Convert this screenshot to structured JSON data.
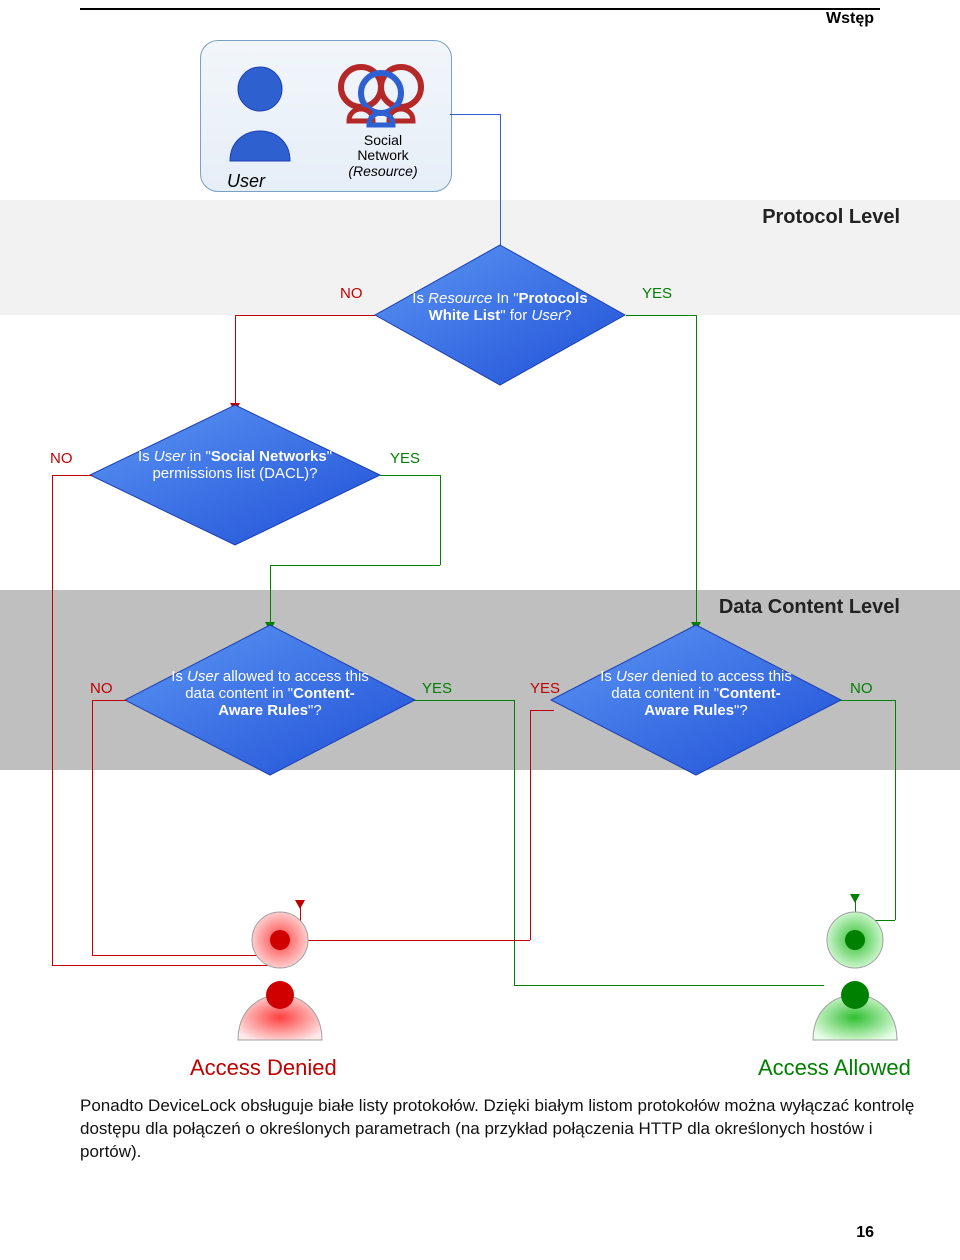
{
  "header": {
    "section_name": "Wstęp",
    "page_number": "16"
  },
  "top_box": {
    "user_label": "User",
    "resource_label_line1": "Social",
    "resource_label_line2": "Network",
    "resource_label_line3": "(Resource)"
  },
  "sections": {
    "protocol_title": "Protocol Level",
    "data_title": "Data Content Level"
  },
  "decisions": {
    "d1": "Is Resource In \"Protocols White List\" for User?",
    "d2": "Is User in \"Social Networks\" permissions list (DACL)?",
    "d3": "Is User allowed to access this data content in \"Content-Aware Rules\"?",
    "d4": "Is User denied to access this data content in \"Content-Aware Rules\"?"
  },
  "edge_labels": {
    "yes": "YES",
    "no": "NO"
  },
  "results": {
    "denied": "Access Denied",
    "allowed": "Access Allowed"
  },
  "body_text": "Ponadto DeviceLock obsługuje białe listy protokołów. Dzięki białym listom protokołów można wyłączać kontrolę dostępu dla połączeń o określonych parametrach (na przykład połączenia HTTP dla określonych hostów i portów).",
  "chart_data": {
    "type": "flowchart",
    "start": {
      "id": "start",
      "label": "User + Social Network (Resource)"
    },
    "phases": [
      "Protocol Level",
      "Data Content Level"
    ],
    "nodes": [
      {
        "id": "d1",
        "type": "decision",
        "phase": "Protocol Level",
        "text": "Is Resource In \"Protocols White List\" for User?"
      },
      {
        "id": "d2",
        "type": "decision",
        "phase": "Protocol Level",
        "text": "Is User in \"Social Networks\" permissions list (DACL)?"
      },
      {
        "id": "d3",
        "type": "decision",
        "phase": "Data Content Level",
        "text": "Is User allowed to access this data content in \"Content-Aware Rules\"?"
      },
      {
        "id": "d4",
        "type": "decision",
        "phase": "Data Content Level",
        "text": "Is User denied to access this data content in \"Content-Aware Rules\"?"
      },
      {
        "id": "denied",
        "type": "terminal",
        "label": "Access Denied",
        "color": "red"
      },
      {
        "id": "allowed",
        "type": "terminal",
        "label": "Access Allowed",
        "color": "green"
      }
    ],
    "edges": [
      {
        "from": "start",
        "to": "d1"
      },
      {
        "from": "d1",
        "label": "YES",
        "to": "d4"
      },
      {
        "from": "d1",
        "label": "NO",
        "to": "d2"
      },
      {
        "from": "d2",
        "label": "YES",
        "to": "d3"
      },
      {
        "from": "d2",
        "label": "NO",
        "to": "denied"
      },
      {
        "from": "d3",
        "label": "YES",
        "to": "allowed"
      },
      {
        "from": "d3",
        "label": "NO",
        "to": "denied"
      },
      {
        "from": "d4",
        "label": "YES",
        "to": "denied"
      },
      {
        "from": "d4",
        "label": "NO",
        "to": "allowed"
      }
    ]
  }
}
